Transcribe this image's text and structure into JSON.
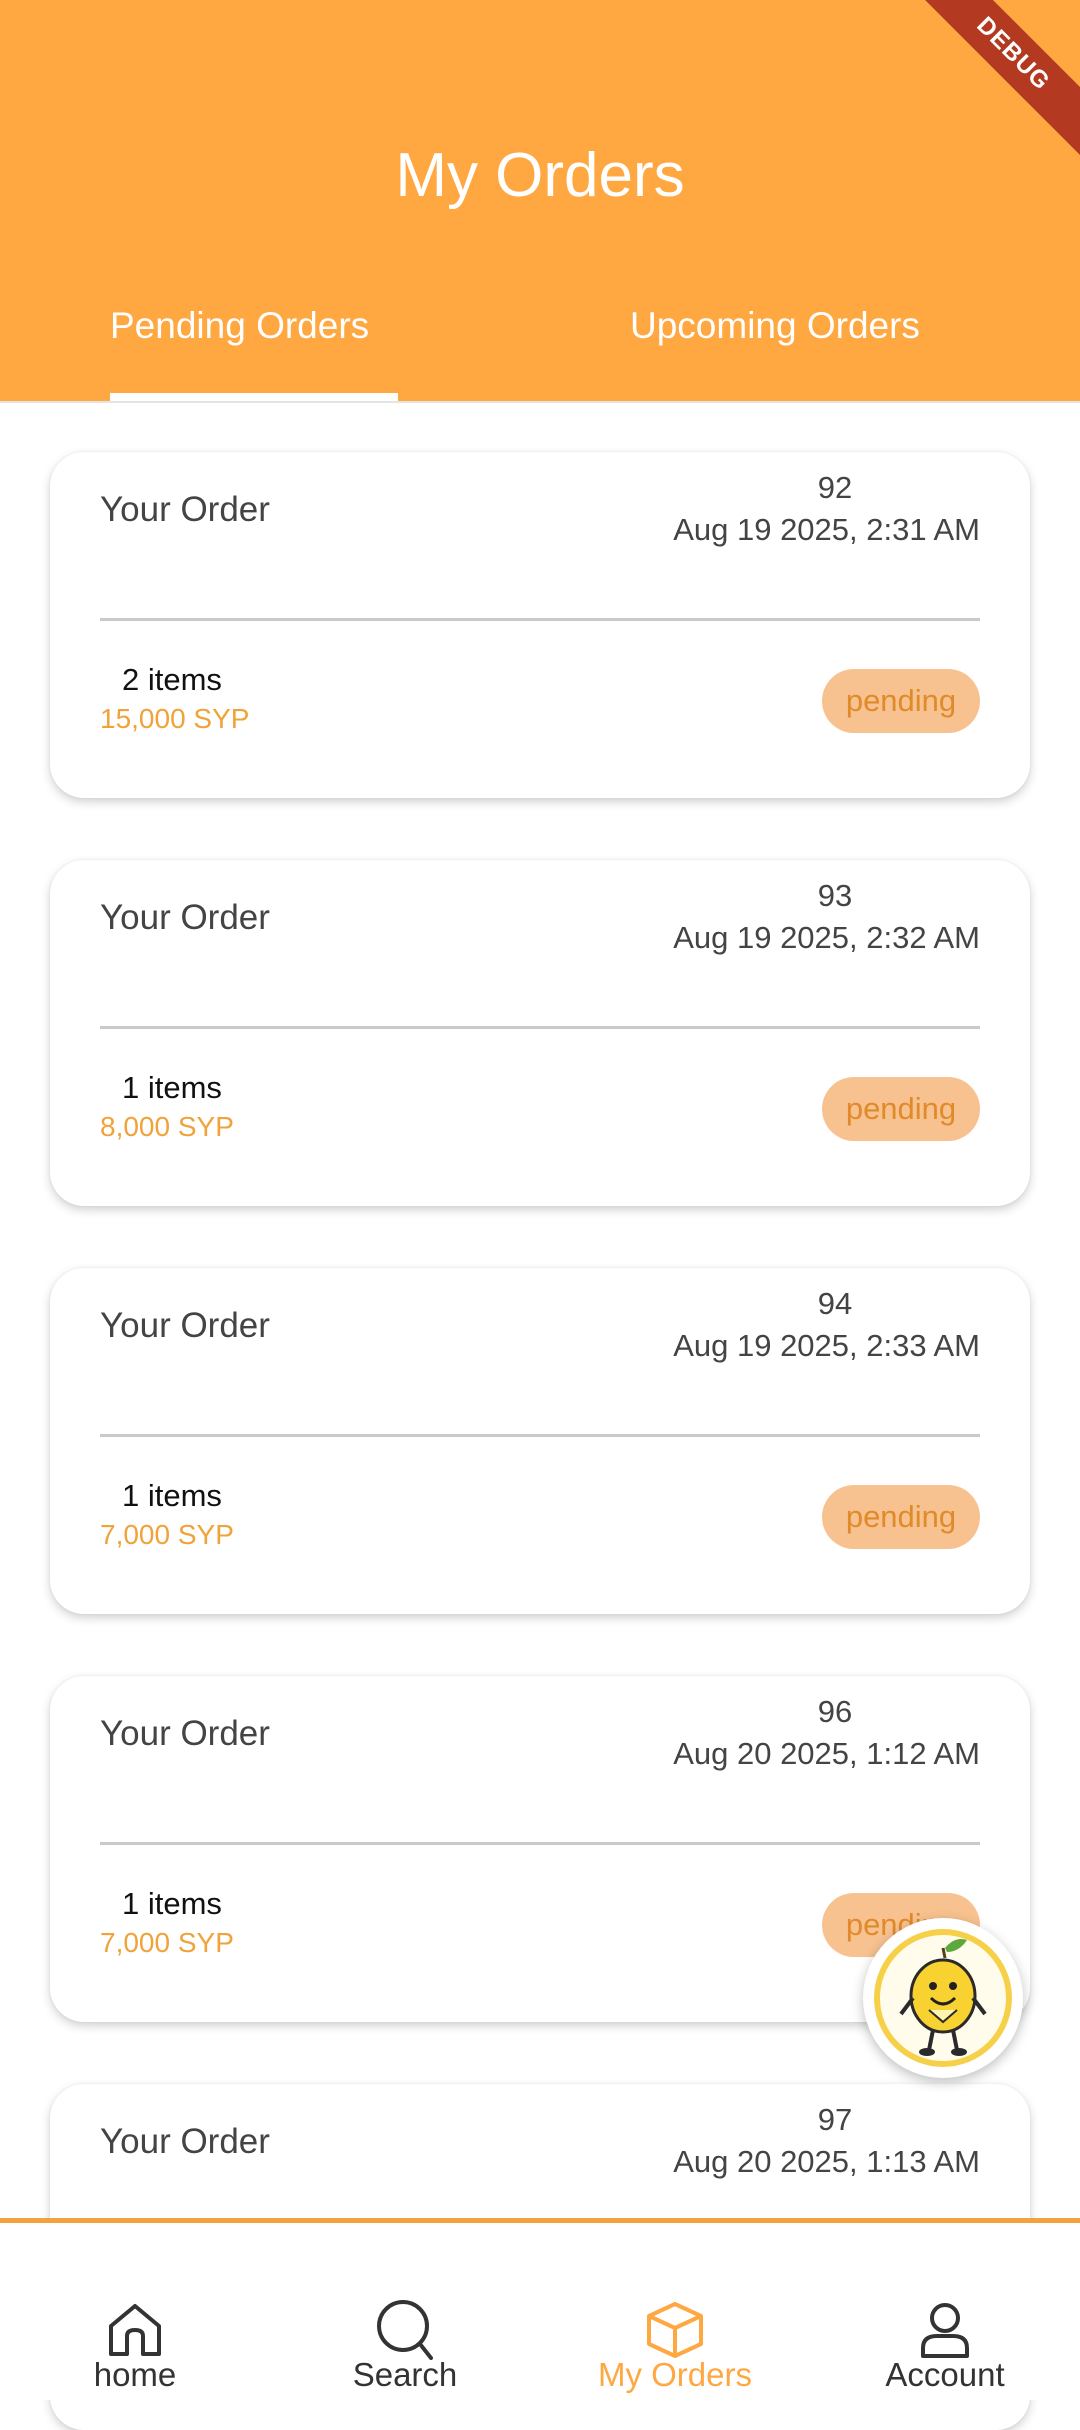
{
  "header": {
    "title": "My Orders",
    "debug_label": "DEBUG",
    "tabs": [
      {
        "label": "Pending Orders",
        "active": true
      },
      {
        "label": "Upcoming Orders",
        "active": false
      }
    ]
  },
  "orders": [
    {
      "title": "Your Order",
      "id": "92",
      "date": "Aug 19 2025, 2:31 AM",
      "items": "2 items",
      "price": "15,000 SYP",
      "status": "pending"
    },
    {
      "title": "Your Order",
      "id": "93",
      "date": "Aug 19 2025, 2:32 AM",
      "items": "1 items",
      "price": "8,000 SYP",
      "status": "pending"
    },
    {
      "title": "Your Order",
      "id": "94",
      "date": "Aug 19 2025, 2:33 AM",
      "items": "1 items",
      "price": "7,000 SYP",
      "status": "pending"
    },
    {
      "title": "Your Order",
      "id": "96",
      "date": "Aug 20 2025, 1:12 AM",
      "items": "1 items",
      "price": "7,000 SYP",
      "status": "pending"
    },
    {
      "title": "Your Order",
      "id": "97",
      "date": "Aug 20 2025, 1:13 AM",
      "items": "",
      "price": "",
      "status": ""
    }
  ],
  "fab": {
    "icon": "lemon-mascot-icon"
  },
  "bottom_nav": [
    {
      "label": "home",
      "icon": "home-icon",
      "active": false
    },
    {
      "label": "Search",
      "icon": "search-icon",
      "active": false
    },
    {
      "label": "My Orders",
      "icon": "box-icon",
      "active": true
    },
    {
      "label": "Account",
      "icon": "user-icon",
      "active": false
    }
  ],
  "colors": {
    "accent": "#FFA841",
    "price": "#F0A33A",
    "badge_bg": "#F7C28F",
    "badge_text": "#E08A2A",
    "debug_banner": "#B33A20"
  }
}
